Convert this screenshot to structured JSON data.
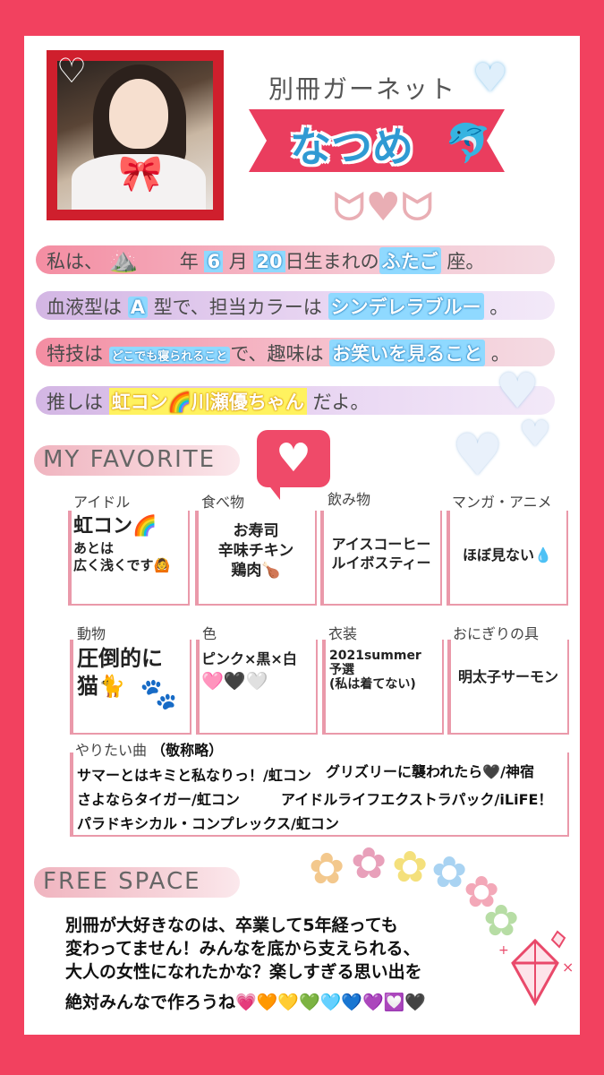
{
  "header": {
    "group_name": "別冊ガーネット",
    "member_name": "なつめ",
    "member_emoji": "🐬"
  },
  "profile": {
    "birth": {
      "prefix": "私は、",
      "year_emoji": "⛰️",
      "year_suffix": "年",
      "month": "6",
      "month_suffix": "月",
      "day": "20",
      "day_suffix": "日生まれの",
      "sign": "ふたご",
      "sign_suffix": "座。"
    },
    "blood": {
      "prefix": "血液型は",
      "type": "A",
      "middle": "型で、担当カラーは",
      "color": "シンデレラブルー",
      "suffix": "。"
    },
    "skill": {
      "prefix": "特技は",
      "skill": "どこでも寝られること",
      "middle": "で、趣味は",
      "hobby": "お笑いを見ること",
      "suffix": "。"
    },
    "oshi": {
      "prefix": "推しは",
      "oshi": "虹コン🌈川瀬優ちゃん",
      "suffix": "だよ。"
    }
  },
  "favorite": {
    "section_title": "MY FAVORITE",
    "items": [
      {
        "label": "アイドル",
        "main": "虹コン🌈",
        "sub1": "あとは",
        "sub2": "広く浅くです🙆"
      },
      {
        "label": "食べ物",
        "line1": "お寿司",
        "line2": "辛味チキン",
        "line3": "鶏肉🍗"
      },
      {
        "label": "飲み物",
        "line1": "アイスコーヒー",
        "line2": "ルイボスティー"
      },
      {
        "label": "マンガ・アニメ",
        "line1": "ほぼ見ない💧"
      },
      {
        "label": "動物",
        "line1": "圧倒的に",
        "line2": "猫🐈"
      },
      {
        "label": "色",
        "line1": "ピンク×黒×白",
        "line2": "🩷🖤🤍"
      },
      {
        "label": "衣装",
        "line1": "2021summer",
        "line2": "予選",
        "line3": "(私は着てない)"
      },
      {
        "label": "おにぎりの具",
        "line1": "明太子サーモン"
      }
    ],
    "songs_label": "やりたい曲",
    "songs_note": "（敬称略）",
    "songs": [
      "サマーとはキミと私なりっ！/虹コン",
      "グリズリーに襲われたら🖤/神宿",
      "さよならタイガー/虹コン",
      "アイドルライフエクストラパック/iLiFE！",
      "パラドキシカル・コンプレックス/虹コン"
    ]
  },
  "free_space": {
    "section_title": "FREE SPACE",
    "line1": "別冊が大好きなのは、卒業して5年経っても",
    "line2": "変わってません！みんなを底から支えられる、",
    "line3": "大人の女性になれたかな？楽しすぎる思い出を",
    "line4": "絶対みんなで作ろうね💗🧡💛💚🩵💙💜💟🖤"
  },
  "colors": {
    "background": "#f2415f",
    "accent_blue": "#2f9ad3",
    "ribbon": "#ea3d5e"
  }
}
